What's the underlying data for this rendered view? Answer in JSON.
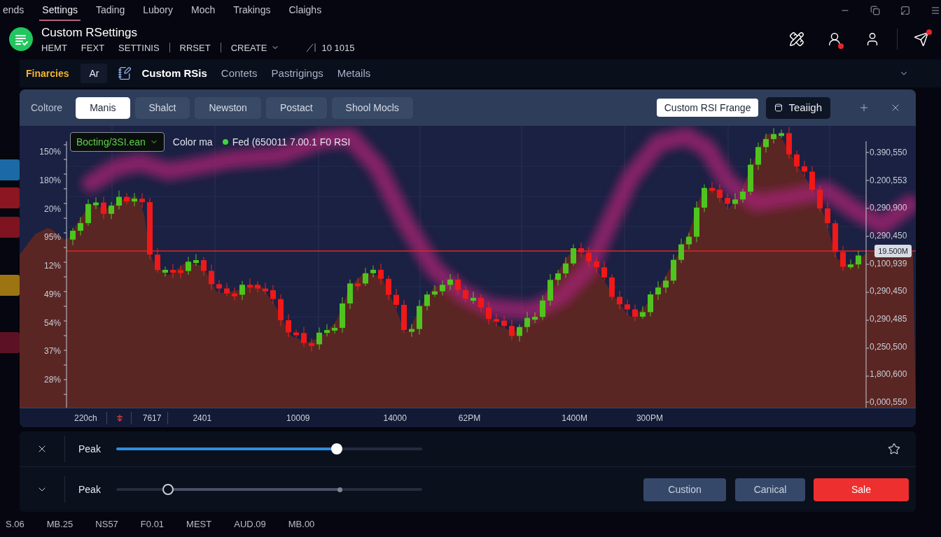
{
  "menu_bar": {
    "items": [
      {
        "label": "ends",
        "selected": false
      },
      {
        "label": "Settings",
        "selected": true
      },
      {
        "label": "Tading",
        "selected": false
      },
      {
        "label": "Lubory",
        "selected": false
      },
      {
        "label": "Moch",
        "selected": false
      },
      {
        "label": "Trakings",
        "selected": false
      },
      {
        "label": "Claighs",
        "selected": false
      }
    ]
  },
  "header": {
    "title": "Custom RSettings",
    "action_groups": [
      [
        {
          "label": "HEMT",
          "kind": "link"
        },
        {
          "label": "FEXT",
          "kind": "link"
        },
        {
          "label": "SETTINIS",
          "kind": "link"
        }
      ],
      [
        {
          "label": "RRSET",
          "kind": "link"
        }
      ],
      [
        {
          "label": "CREATE",
          "kind": "menu"
        }
      ]
    ],
    "counter": "10 1015",
    "icons": [
      {
        "badge": false
      },
      {
        "badge": true
      },
      {
        "badge": false
      },
      {
        "badge": true
      }
    ]
  },
  "nav": {
    "brand": "Finarcies",
    "chip": "Ar",
    "tabs": [
      {
        "label": "Custom RSis",
        "selected": true
      },
      {
        "label": "Contets",
        "selected": false
      },
      {
        "label": "Pastrigings",
        "selected": false
      },
      {
        "label": "Metails",
        "selected": false
      }
    ]
  },
  "edge_tabs": [
    {
      "color": "#1b6aa5"
    },
    {
      "color": "#8c1622"
    },
    {
      "color": "#7e1420"
    },
    {
      "color": "#9c7412"
    },
    {
      "color": "#5c1224"
    }
  ],
  "panel": {
    "tabs_label": "Coltore",
    "tabs": [
      {
        "label": "Manis",
        "selected": true
      },
      {
        "label": "Shalct",
        "selected": false
      },
      {
        "label": "Newston",
        "selected": false
      },
      {
        "label": "Postact",
        "selected": false
      },
      {
        "label": "Shool Mocls",
        "selected": false
      }
    ],
    "range_button": "Custom RSI Frange",
    "theme_button": "Teaiigh"
  },
  "chart": {
    "symbol_select": "Bocting/3SI.ean",
    "color_label": "Color ma",
    "legend": "Fed (650011 7.00.1 F0 RSI",
    "left_axis": [
      "150%",
      "180%",
      "20%",
      "95%",
      "12%",
      "49%",
      "54%",
      "37%",
      "28%"
    ],
    "right_axis": [
      "0.390,550",
      "0.200,553",
      "0,290,900",
      "0,290,450",
      "0,100,939",
      "0,290,450",
      "0,290,485",
      "0,250,500",
      "1,800,600",
      "0,000,550"
    ],
    "price_tag": "19.500M",
    "x_axis": [
      "220ch",
      "7617",
      "2401",
      "10009",
      "14000",
      "62PM",
      "1400M",
      "300PM"
    ]
  },
  "controls": {
    "sliders": [
      {
        "label": "Peak",
        "handles": [
          {
            "kind": "thumb",
            "level": 0.72
          }
        ]
      },
      {
        "label": "Peak",
        "handles": [
          {
            "kind": "ring",
            "level": 0.17
          },
          {
            "kind": "dot",
            "level": 0.73
          }
        ]
      }
    ],
    "buttons": [
      {
        "label": "Custion",
        "kind": "secondary"
      },
      {
        "label": "Canical",
        "kind": "secondary"
      },
      {
        "label": "Sale",
        "kind": "primary"
      }
    ]
  },
  "ticker": [
    "S.06",
    "MB.25",
    "NS57",
    "F0.01",
    "MEST",
    "AUD.09",
    "MB.00"
  ]
}
